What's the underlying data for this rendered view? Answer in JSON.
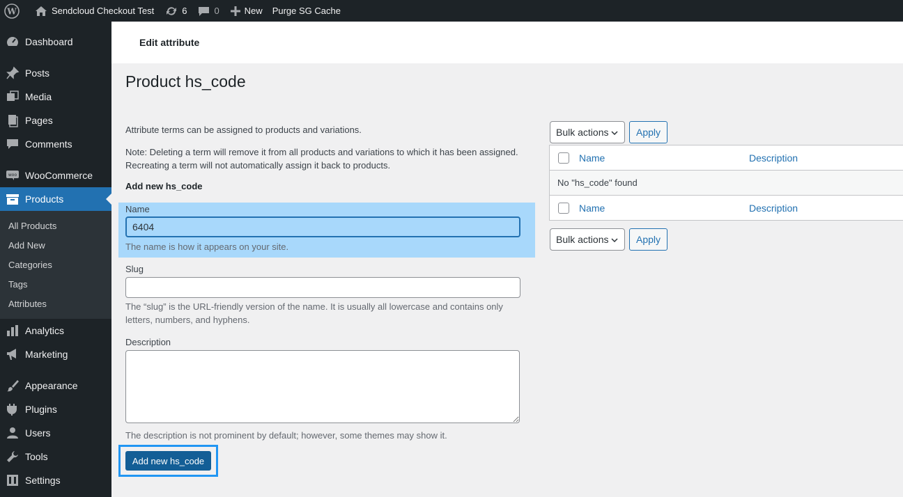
{
  "adminbar": {
    "site_name": "Sendcloud Checkout Test",
    "updates_count": "6",
    "comments_count": "0",
    "new_label": "New",
    "purge_label": "Purge SG Cache"
  },
  "sidebar": {
    "items": [
      {
        "label": "Dashboard",
        "icon": "dashboard-icon"
      },
      {
        "label": "Posts",
        "icon": "pin-icon"
      },
      {
        "label": "Media",
        "icon": "media-icon"
      },
      {
        "label": "Pages",
        "icon": "pages-icon"
      },
      {
        "label": "Comments",
        "icon": "comment-icon"
      },
      {
        "label": "WooCommerce",
        "icon": "woo-icon"
      },
      {
        "label": "Products",
        "icon": "archive-icon"
      },
      {
        "label": "Analytics",
        "icon": "chart-icon"
      },
      {
        "label": "Marketing",
        "icon": "megaphone-icon"
      },
      {
        "label": "Appearance",
        "icon": "brush-icon"
      },
      {
        "label": "Plugins",
        "icon": "plugin-icon"
      },
      {
        "label": "Users",
        "icon": "user-icon"
      },
      {
        "label": "Tools",
        "icon": "wrench-icon"
      },
      {
        "label": "Settings",
        "icon": "settings-icon"
      }
    ],
    "submenu": [
      "All Products",
      "Add New",
      "Categories",
      "Tags",
      "Attributes"
    ]
  },
  "header": {
    "title": "Edit attribute"
  },
  "page": {
    "title": "Product hs_code",
    "intro": "Attribute terms can be assigned to products and variations.",
    "note_line1": "Note: Deleting a term will remove it from all products and variations to which it has been assigned.",
    "note_line2": "Recreating a term will not automatically assign it back to products.",
    "form_heading": "Add new hs_code"
  },
  "form": {
    "name_label": "Name",
    "name_value": "6404",
    "name_help": "The name is how it appears on your site.",
    "slug_label": "Slug",
    "slug_value": "",
    "slug_help_line1": "The “slug” is the URL-friendly version of the name. It is usually all lowercase and contains only",
    "slug_help_line2": "letters, numbers, and hyphens.",
    "description_label": "Description",
    "description_value": "",
    "description_help": "The description is not prominent by default; however, some themes may show it.",
    "submit_label": "Add new hs_code"
  },
  "table": {
    "bulk_actions": "Bulk actions",
    "apply": "Apply",
    "col_name": "Name",
    "col_description": "Description",
    "no_items": "No \"hs_code\" found"
  },
  "colors": {
    "accent": "#2271b1",
    "highlight": "#a8d8fb",
    "dark": "#1d2327"
  }
}
